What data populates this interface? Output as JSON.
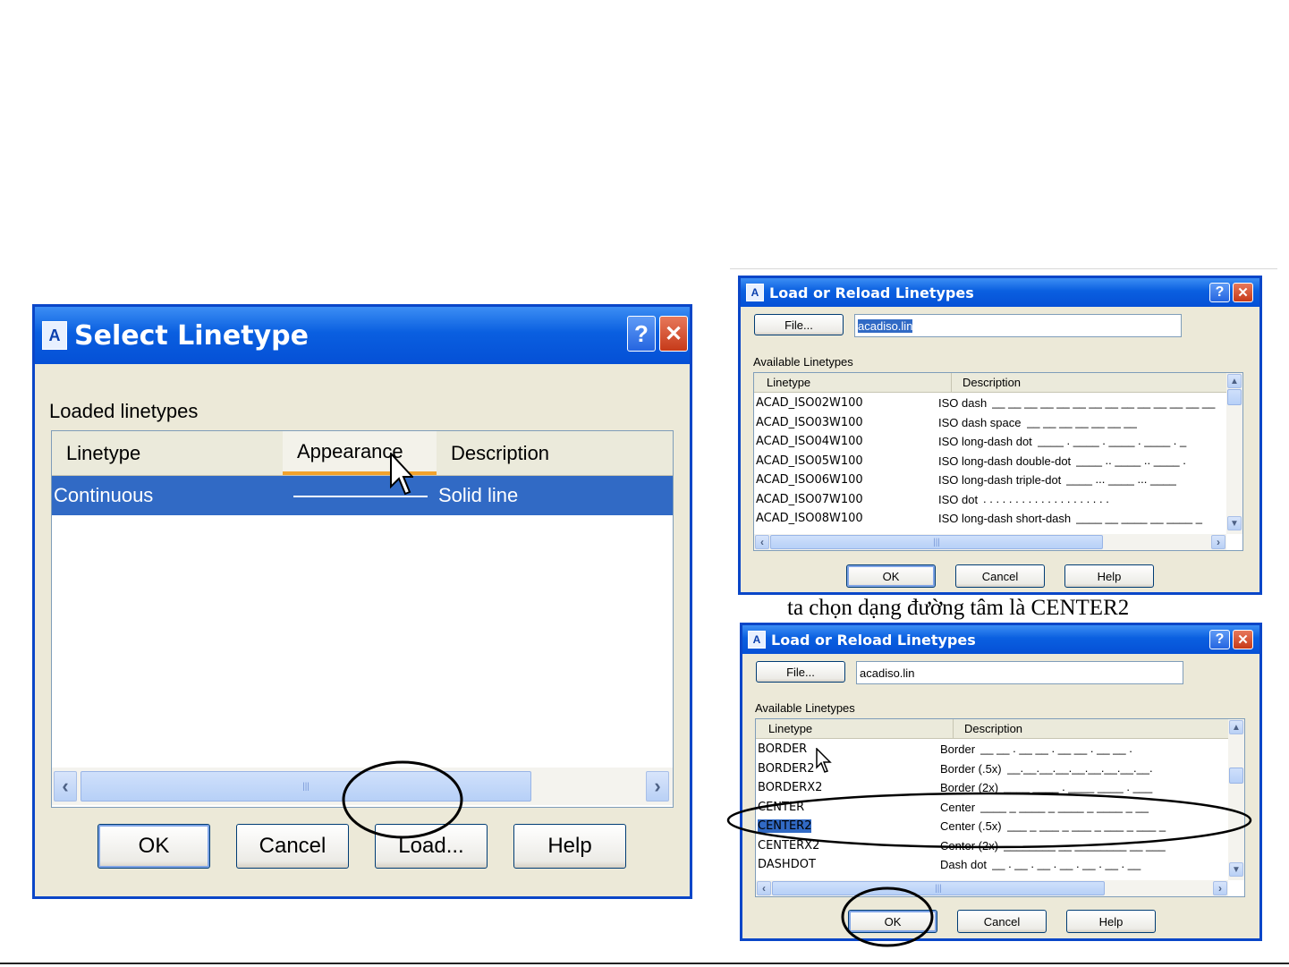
{
  "select_dialog": {
    "title": "Select Linetype",
    "help_glyph": "?",
    "close_glyph": "✕",
    "loaded_label": "Loaded linetypes",
    "columns": {
      "linetype": "Linetype",
      "appearance": "Appearance",
      "description": "Description"
    },
    "rows": [
      {
        "linetype": "Continuous",
        "description": "Solid line",
        "selected": true
      }
    ],
    "scroll_thumb_grip": "|||",
    "buttons": {
      "ok": "OK",
      "cancel": "Cancel",
      "load": "Load...",
      "help": "Help"
    }
  },
  "caption": "ta chọn dạng đường tâm là CENTER2",
  "load_dialog_1": {
    "title": "Load or Reload Linetypes",
    "file_button": "File...",
    "file_value": "acadiso.lin",
    "available_label": "Available Linetypes",
    "columns": {
      "linetype": "Linetype",
      "description": "Description"
    },
    "rows": [
      {
        "linetype": "ACAD_ISO02W100",
        "description": "ISO dash",
        "pattern": "__ __ __ __ __ __ __ __ __ __ __ __ __ __"
      },
      {
        "linetype": "ACAD_ISO03W100",
        "description": "ISO dash space",
        "pattern": "__    __    __    __    __    __    __"
      },
      {
        "linetype": "ACAD_ISO04W100",
        "description": "ISO long-dash dot",
        "pattern": "____ . ____ . ____ . ____ . _"
      },
      {
        "linetype": "ACAD_ISO05W100",
        "description": "ISO long-dash double-dot",
        "pattern": "____ .. ____ .. ____ ."
      },
      {
        "linetype": "ACAD_ISO06W100",
        "description": "ISO long-dash triple-dot",
        "pattern": "____ ... ____ ... ____"
      },
      {
        "linetype": "ACAD_ISO07W100",
        "description": "ISO dot",
        "pattern": ". . . . . . . . . . . . . . . . . . . ."
      },
      {
        "linetype": "ACAD_ISO08W100",
        "description": "ISO long-dash short-dash",
        "pattern": "____ __ ____ __ ____ _"
      }
    ],
    "scroll_thumb_grip": "|||",
    "buttons": {
      "ok": "OK",
      "cancel": "Cancel",
      "help": "Help"
    }
  },
  "load_dialog_2": {
    "title": "Load or Reload Linetypes",
    "file_button": "File...",
    "file_value": "acadiso.lin",
    "available_label": "Available Linetypes",
    "columns": {
      "linetype": "Linetype",
      "description": "Description"
    },
    "rows": [
      {
        "linetype": "BORDER",
        "description": "Border",
        "pattern": "__ __ . __ __ . __ __ . __ __ ."
      },
      {
        "linetype": "BORDER2",
        "description": "Border (.5x)",
        "pattern": "__.__.__.__.__.__.__.__.__."
      },
      {
        "linetype": "BORDERX2",
        "description": "Border (2x)",
        "pattern": "____ ____ . ____ ____ . ___"
      },
      {
        "linetype": "CENTER",
        "description": "Center",
        "pattern": "____ _ ____ _ ____ _ ____ _ __"
      },
      {
        "linetype": "CENTER2",
        "description": "Center (.5x)",
        "pattern": "___ _ ___ _ ___ _ ___ _ ___ _",
        "selected": true
      },
      {
        "linetype": "CENTERX2",
        "description": "Center (2x)",
        "pattern": "________  __  ________  __  ___"
      },
      {
        "linetype": "DASHDOT",
        "description": "Dash dot",
        "pattern": "__ . __ . __ . __ . __ . __ . __"
      }
    ],
    "scroll_thumb_grip": "|||",
    "buttons": {
      "ok": "OK",
      "cancel": "Cancel",
      "help": "Help"
    }
  },
  "colors": {
    "title_blue": "#0a5fe0",
    "selection": "#316ac5",
    "dialog_face": "#ece9d8",
    "annotation": "#000000"
  }
}
